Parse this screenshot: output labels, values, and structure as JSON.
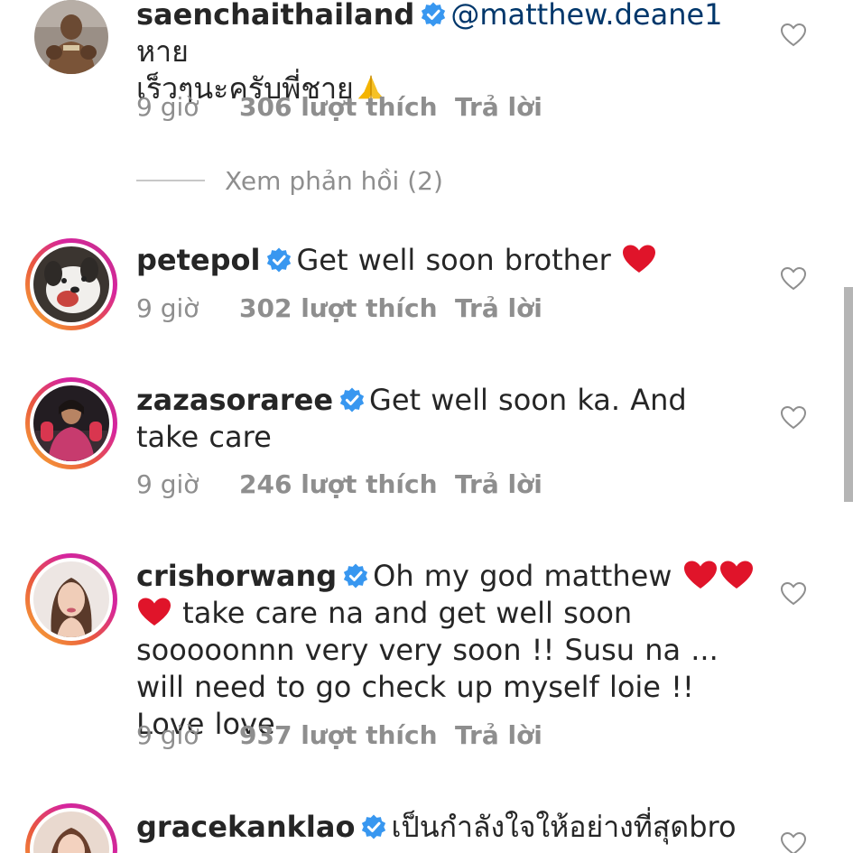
{
  "comments": [
    {
      "username": "saenchaithailand",
      "mention": "@matthew.deane1",
      "text_line1": " หาย",
      "text_line2": "เร็วๆนะครับพี่ชาย",
      "time": "9 giờ",
      "likes": "306 lượt thích",
      "reply": "Trả lời",
      "view_replies": "Xem phản hồi (2)"
    },
    {
      "username": "petepol",
      "text": "Get well soon brother",
      "time": "9 giờ",
      "likes": "302 lượt thích",
      "reply": "Trả lời"
    },
    {
      "username": "zazasoraree",
      "text": "Get well soon ka. And take care",
      "time": "9 giờ",
      "likes": "246 lượt thích",
      "reply": "Trả lời"
    },
    {
      "username": "crishorwang",
      "text_a": "Oh my god matthew",
      "text_b": "take care na and get well soon sooooonnn very very soon !! Susu na ... will need to go check up myself loie !! Love love",
      "time": "9 giờ",
      "likes": "937 lượt thích",
      "reply": "Trả lời"
    },
    {
      "username": "gracekanklao",
      "text": "เป็นกำลังใจให้อย่างที่สุดbro"
    }
  ],
  "icons": {
    "verified": "verified-badge-icon",
    "heart_emoji": "red-heart-emoji",
    "pray_emoji": "folded-hands-emoji",
    "like": "heart-outline-icon"
  },
  "colors": {
    "verified_blue": "#3897f0",
    "heart_red": "#e0142a",
    "mention_blue": "#00376b",
    "meta_gray": "#8e8e8e"
  }
}
